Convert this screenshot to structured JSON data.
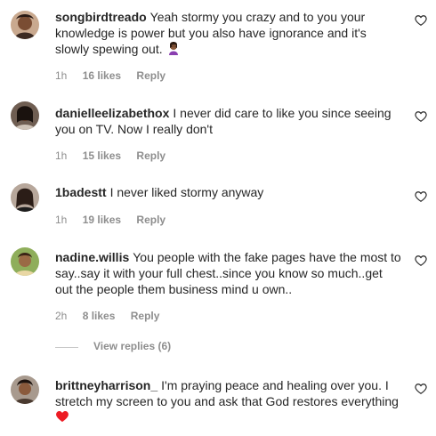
{
  "comments": [
    {
      "username": "songbirdtreado",
      "text": "Yeah stormy you crazy and to you your knowledge is power but you also have ignorance and it's slowly spewing out.",
      "emoji": "woman-facepalming-emoji",
      "time": "1h",
      "likes": "16 likes",
      "reply": "Reply"
    },
    {
      "username": "danielleelizabethox",
      "text": "I never did care to like you since seeing you on TV. Now I really don't",
      "time": "1h",
      "likes": "15 likes",
      "reply": "Reply"
    },
    {
      "username": "1badestt",
      "text": "I never liked stormy anyway",
      "time": "1h",
      "likes": "19 likes",
      "reply": "Reply"
    },
    {
      "username": "nadine.willis",
      "text": "You people with the fake pages have the most to say..say it with your full chest..since you know so much..get out the people them business mind u own..",
      "time": "2h",
      "likes": "8 likes",
      "reply": "Reply"
    },
    {
      "username": "brittneyharrison_",
      "text": "I'm praying peace and healing over you. I stretch my screen to you and ask that God restores everything",
      "emoji": "red-heart-emoji"
    }
  ],
  "view_replies": "View replies (6)",
  "colors": {
    "text": "#262626",
    "muted": "#8e8e8e",
    "heart": "#ed1c24"
  },
  "icons": {
    "like": "heart-outline-icon"
  }
}
